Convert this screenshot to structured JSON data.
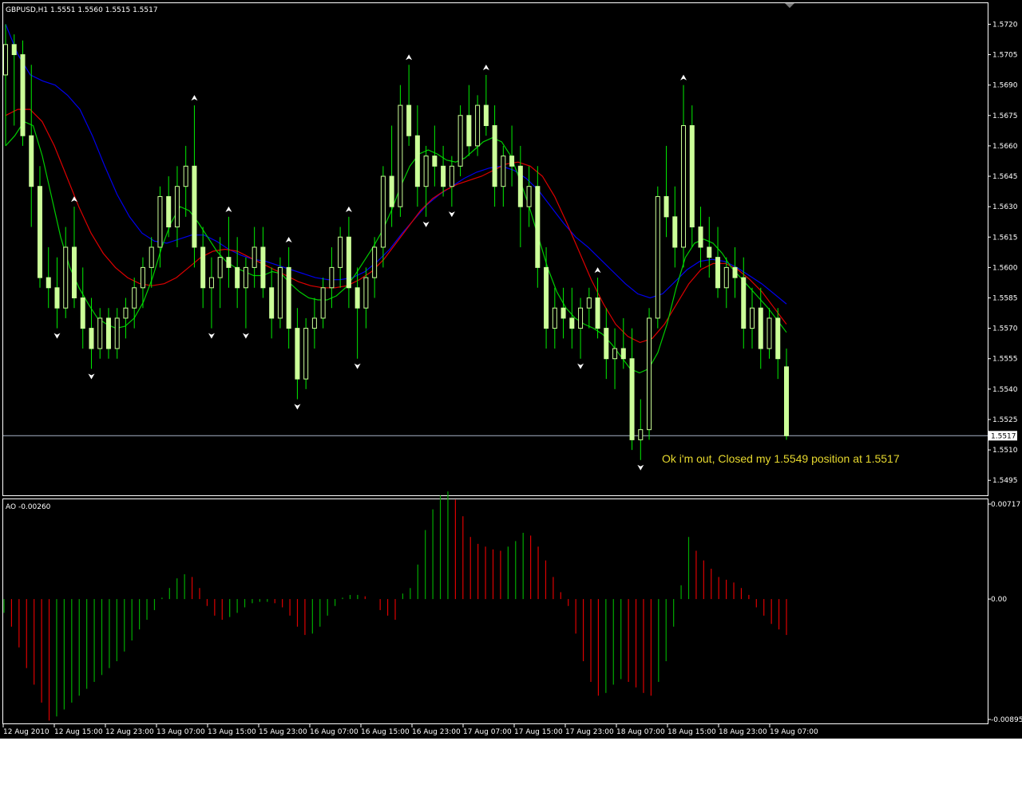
{
  "chart_data": [
    {
      "type": "candlestick",
      "title": "GBPUSD,H1  1.5551 1.5560 1.5515 1.5517",
      "ylim": [
        1.5488,
        1.573
      ],
      "y_ticks": [
        "1.5720",
        "1.5705",
        "1.5690",
        "1.5675",
        "1.5660",
        "1.5645",
        "1.5630",
        "1.5615",
        "1.5600",
        "1.5585",
        "1.5570",
        "1.5555",
        "1.5540",
        "1.5525",
        "1.5510",
        "1.5495"
      ],
      "current_price_label": "1.5517",
      "current_price": 1.5517,
      "annotation": "Ok i'm out, Closed my 1.5549 position at 1.5517",
      "colors": {
        "candle": "#ccff99",
        "ma_fast": "#00cc00",
        "ma_mid": "#dd0000",
        "ma_slow": "#0000ee",
        "fractal": "#ffffff"
      },
      "candles": [
        [
          1.5695,
          1.572,
          1.566,
          1.571
        ],
        [
          1.571,
          1.5715,
          1.567,
          1.5705
        ],
        [
          1.5705,
          1.5712,
          1.566,
          1.5665
        ],
        [
          1.5665,
          1.57,
          1.562,
          1.564
        ],
        [
          1.564,
          1.565,
          1.559,
          1.5595
        ],
        [
          1.5595,
          1.561,
          1.558,
          1.559
        ],
        [
          1.559,
          1.5605,
          1.557,
          1.558
        ],
        [
          1.558,
          1.562,
          1.5575,
          1.561
        ],
        [
          1.561,
          1.563,
          1.558,
          1.5585
        ],
        [
          1.5585,
          1.56,
          1.556,
          1.557
        ],
        [
          1.557,
          1.5585,
          1.555,
          1.556
        ],
        [
          1.556,
          1.558,
          1.5555,
          1.5575
        ],
        [
          1.5575,
          1.558,
          1.5555,
          1.556
        ],
        [
          1.556,
          1.558,
          1.5555,
          1.5575
        ],
        [
          1.5575,
          1.5585,
          1.5565,
          1.558
        ],
        [
          1.558,
          1.5595,
          1.557,
          1.559
        ],
        [
          1.559,
          1.5605,
          1.558,
          1.56
        ],
        [
          1.56,
          1.5615,
          1.559,
          1.561
        ],
        [
          1.561,
          1.564,
          1.56,
          1.5635
        ],
        [
          1.5635,
          1.5645,
          1.5615,
          1.562
        ],
        [
          1.562,
          1.565,
          1.561,
          1.564
        ],
        [
          1.564,
          1.566,
          1.5625,
          1.565
        ],
        [
          1.565,
          1.568,
          1.56,
          1.561
        ],
        [
          1.561,
          1.562,
          1.558,
          1.559
        ],
        [
          1.559,
          1.5605,
          1.557,
          1.5595
        ],
        [
          1.5595,
          1.5615,
          1.558,
          1.5605
        ],
        [
          1.5605,
          1.5625,
          1.559,
          1.56
        ],
        [
          1.56,
          1.5615,
          1.558,
          1.559
        ],
        [
          1.559,
          1.5605,
          1.557,
          1.56
        ],
        [
          1.56,
          1.562,
          1.559,
          1.561
        ],
        [
          1.561,
          1.562,
          1.5585,
          1.559
        ],
        [
          1.559,
          1.56,
          1.5565,
          1.5575
        ],
        [
          1.5575,
          1.5605,
          1.557,
          1.56
        ],
        [
          1.56,
          1.561,
          1.556,
          1.557
        ],
        [
          1.557,
          1.558,
          1.5535,
          1.5545
        ],
        [
          1.5545,
          1.5575,
          1.554,
          1.557
        ],
        [
          1.557,
          1.5585,
          1.556,
          1.5575
        ],
        [
          1.5575,
          1.5595,
          1.557,
          1.559
        ],
        [
          1.559,
          1.561,
          1.558,
          1.56
        ],
        [
          1.56,
          1.562,
          1.559,
          1.5615
        ],
        [
          1.5615,
          1.5625,
          1.558,
          1.559
        ],
        [
          1.559,
          1.56,
          1.5555,
          1.558
        ],
        [
          1.558,
          1.56,
          1.557,
          1.5595
        ],
        [
          1.5595,
          1.5615,
          1.5585,
          1.561
        ],
        [
          1.561,
          1.565,
          1.56,
          1.5645
        ],
        [
          1.5645,
          1.567,
          1.562,
          1.563
        ],
        [
          1.563,
          1.569,
          1.5625,
          1.568
        ],
        [
          1.568,
          1.57,
          1.566,
          1.5665
        ],
        [
          1.5665,
          1.568,
          1.563,
          1.564
        ],
        [
          1.564,
          1.566,
          1.5625,
          1.5655
        ],
        [
          1.5655,
          1.567,
          1.564,
          1.565
        ],
        [
          1.565,
          1.566,
          1.5635,
          1.564
        ],
        [
          1.564,
          1.5655,
          1.563,
          1.565
        ],
        [
          1.565,
          1.568,
          1.5645,
          1.5675
        ],
        [
          1.5675,
          1.569,
          1.5655,
          1.566
        ],
        [
          1.566,
          1.5685,
          1.5655,
          1.568
        ],
        [
          1.568,
          1.5695,
          1.5665,
          1.567
        ],
        [
          1.567,
          1.568,
          1.563,
          1.564
        ],
        [
          1.564,
          1.566,
          1.563,
          1.5655
        ],
        [
          1.5655,
          1.567,
          1.564,
          1.565
        ],
        [
          1.565,
          1.566,
          1.561,
          1.563
        ],
        [
          1.563,
          1.565,
          1.562,
          1.564
        ],
        [
          1.564,
          1.565,
          1.559,
          1.56
        ],
        [
          1.56,
          1.561,
          1.556,
          1.557
        ],
        [
          1.557,
          1.559,
          1.556,
          1.558
        ],
        [
          1.558,
          1.559,
          1.5565,
          1.5575
        ],
        [
          1.5575,
          1.559,
          1.556,
          1.557
        ],
        [
          1.557,
          1.5585,
          1.5555,
          1.558
        ],
        [
          1.558,
          1.559,
          1.557,
          1.5585
        ],
        [
          1.5585,
          1.5595,
          1.5565,
          1.557
        ],
        [
          1.557,
          1.558,
          1.5545,
          1.5555
        ],
        [
          1.5555,
          1.557,
          1.554,
          1.556
        ],
        [
          1.556,
          1.5575,
          1.555,
          1.5555
        ],
        [
          1.5555,
          1.557,
          1.551,
          1.5515
        ],
        [
          1.5515,
          1.5535,
          1.5505,
          1.552
        ],
        [
          1.552,
          1.558,
          1.5515,
          1.5575
        ],
        [
          1.5575,
          1.564,
          1.557,
          1.5635
        ],
        [
          1.5635,
          1.566,
          1.5615,
          1.5625
        ],
        [
          1.5625,
          1.564,
          1.56,
          1.561
        ],
        [
          1.561,
          1.569,
          1.56,
          1.567
        ],
        [
          1.567,
          1.568,
          1.561,
          1.562
        ],
        [
          1.562,
          1.563,
          1.56,
          1.561
        ],
        [
          1.561,
          1.5625,
          1.5595,
          1.5605
        ],
        [
          1.5605,
          1.562,
          1.5585,
          1.559
        ],
        [
          1.559,
          1.5605,
          1.558,
          1.56
        ],
        [
          1.56,
          1.561,
          1.5585,
          1.5595
        ],
        [
          1.5595,
          1.5605,
          1.556,
          1.557
        ],
        [
          1.557,
          1.559,
          1.556,
          1.558
        ],
        [
          1.558,
          1.559,
          1.555,
          1.556
        ],
        [
          1.556,
          1.558,
          1.5555,
          1.5575
        ],
        [
          1.5575,
          1.558,
          1.5545,
          1.5555
        ],
        [
          1.5551,
          1.556,
          1.5515,
          1.5517
        ]
      ],
      "ma_fast": [
        1.566,
        1.5665,
        1.5672,
        1.567,
        1.5655,
        1.5635,
        1.5615,
        1.56,
        1.559,
        1.5582,
        1.5575,
        1.5572,
        1.557,
        1.5571,
        1.5575,
        1.5583,
        1.5595,
        1.561,
        1.5622,
        1.563,
        1.5628,
        1.5622,
        1.5615,
        1.5608,
        1.5603,
        1.56,
        1.5598,
        1.5596,
        1.5596,
        1.5598,
        1.5597,
        1.5592,
        1.5588,
        1.5585,
        1.5584,
        1.5584,
        1.5586,
        1.559,
        1.5596,
        1.5603,
        1.561,
        1.5618,
        1.5628,
        1.564,
        1.565,
        1.5656,
        1.5658,
        1.5656,
        1.5653,
        1.5652,
        1.5654,
        1.5658,
        1.5662,
        1.5664,
        1.5662,
        1.5655,
        1.5643,
        1.563,
        1.5615,
        1.56,
        1.5588,
        1.558,
        1.5575,
        1.5572,
        1.557,
        1.5567,
        1.5562,
        1.5556,
        1.555,
        1.5548,
        1.555,
        1.5558,
        1.5572,
        1.559,
        1.5605,
        1.5612,
        1.5614,
        1.5612,
        1.5607,
        1.56,
        1.5595,
        1.559,
        1.5585,
        1.558,
        1.5574,
        1.5568
      ],
      "ma_mid": [
        1.5675,
        1.5678,
        1.5678,
        1.5672,
        1.566,
        1.5645,
        1.563,
        1.5617,
        1.5607,
        1.56,
        1.5595,
        1.5592,
        1.5591,
        1.5592,
        1.5595,
        1.56,
        1.5605,
        1.5608,
        1.5609,
        1.5608,
        1.5605,
        1.5602,
        1.5599,
        1.5596,
        1.5593,
        1.5591,
        1.559,
        1.559,
        1.5591,
        1.5594,
        1.5598,
        1.5604,
        1.5612,
        1.562,
        1.5628,
        1.5634,
        1.5638,
        1.5641,
        1.5643,
        1.5645,
        1.5648,
        1.5651,
        1.5652,
        1.565,
        1.5645,
        1.5635,
        1.5622,
        1.5608,
        1.5594,
        1.5582,
        1.5572,
        1.5566,
        1.5563,
        1.5565,
        1.5572,
        1.5582,
        1.5592,
        1.5599,
        1.5602,
        1.5602,
        1.5599,
        1.5594,
        1.5588,
        1.558,
        1.5572
      ],
      "ma_slow": [
        1.572,
        1.5705,
        1.5695,
        1.5692,
        1.569,
        1.5685,
        1.5678,
        1.5665,
        1.565,
        1.5636,
        1.5625,
        1.5617,
        1.5613,
        1.5612,
        1.5614,
        1.5616,
        1.5616,
        1.5613,
        1.5609,
        1.5606,
        1.5604,
        1.5603,
        1.5601,
        1.5599,
        1.5597,
        1.5595,
        1.5594,
        1.5594,
        1.5595,
        1.5598,
        1.5603,
        1.5609,
        1.5617,
        1.5624,
        1.5631,
        1.5636,
        1.564,
        1.5644,
        1.5647,
        1.5649,
        1.565,
        1.5648,
        1.5644,
        1.5638,
        1.563,
        1.5622,
        1.5615,
        1.561,
        1.5604,
        1.5598,
        1.5592,
        1.5587,
        1.5585,
        1.5587,
        1.5593,
        1.5599,
        1.5603,
        1.5604,
        1.5603,
        1.56,
        1.5596,
        1.5592,
        1.5587,
        1.5582
      ]
    },
    {
      "type": "bar",
      "title": "AO -0.00260",
      "ylim": [
        -0.00895,
        0.00717
      ],
      "y_ticks": [
        "0.00717",
        "0.00",
        "-0.00895"
      ],
      "colors": {
        "up": "#00aa00",
        "down": "#dd0000"
      },
      "values": [
        -0.001,
        -0.002,
        -0.0035,
        -0.005,
        -0.0062,
        -0.0075,
        -0.0088,
        -0.0085,
        -0.008,
        -0.0075,
        -0.007,
        -0.0065,
        -0.006,
        -0.0055,
        -0.005,
        -0.0045,
        -0.0038,
        -0.003,
        -0.0022,
        -0.0015,
        -0.0008,
        0.0001,
        0.0008,
        0.0015,
        0.0018,
        0.0016,
        0.0008,
        -0.0005,
        -0.0012,
        -0.0015,
        -0.0013,
        -0.001,
        -0.0006,
        -0.0003,
        -0.0002,
        -0.0002,
        -0.0003,
        -0.0006,
        -0.0012,
        -0.002,
        -0.0026,
        -0.0025,
        -0.002,
        -0.0012,
        -0.0005,
        0.0001,
        0.0003,
        0.0003,
        0.0002,
        0.0,
        -0.0008,
        -0.0012,
        -0.0015,
        0.0004,
        0.0008,
        0.0025,
        0.005,
        0.0065,
        0.0075,
        0.0078,
        0.0072,
        0.006,
        0.0045,
        0.004,
        0.0038,
        0.0036,
        0.0035,
        0.0038,
        0.0042,
        0.0048,
        0.0046,
        0.0038,
        0.0028,
        0.0016,
        0.0005,
        -0.0005,
        -0.0025,
        -0.0045,
        -0.006,
        -0.007,
        -0.0068,
        -0.0062,
        -0.0058,
        -0.006,
        -0.0064,
        -0.0068,
        -0.007,
        -0.006,
        -0.0045,
        -0.002,
        0.001,
        0.0045,
        0.0035,
        0.0028,
        0.0022,
        0.0016,
        0.0014,
        0.0012,
        0.0008,
        0.0003,
        -0.0006,
        -0.0012,
        -0.0018,
        -0.0022,
        -0.0026
      ],
      "colors_seq": "auto"
    }
  ],
  "x_axis_labels": [
    "12 Aug 2010",
    "12 Aug 15:00",
    "12 Aug 23:00",
    "13 Aug 07:00",
    "13 Aug 15:00",
    "15 Aug 23:00",
    "16 Aug 07:00",
    "16 Aug 15:00",
    "16 Aug 23:00",
    "17 Aug 07:00",
    "17 Aug 15:00",
    "17 Aug 23:00",
    "18 Aug 07:00",
    "18 Aug 15:00",
    "18 Aug 23:00",
    "19 Aug 07:00"
  ]
}
